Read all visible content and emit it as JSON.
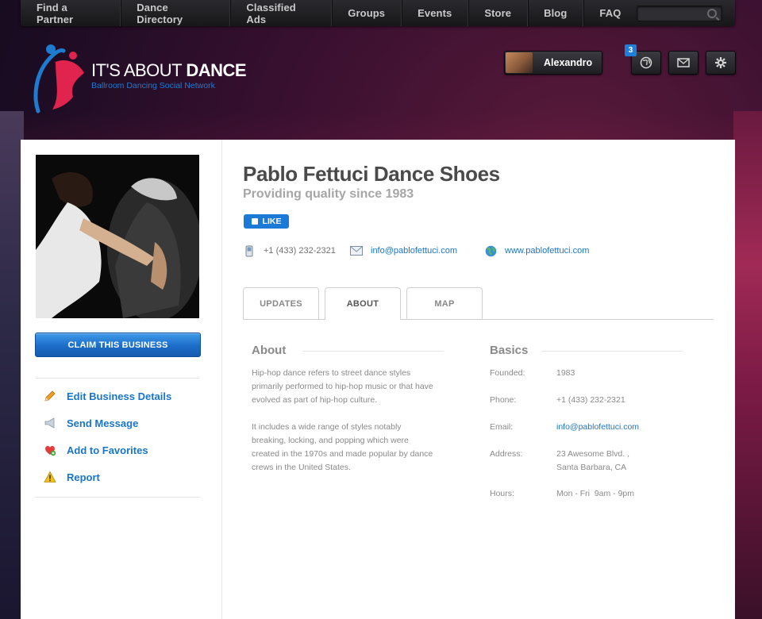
{
  "nav": {
    "items": [
      "Find a Partner",
      "Dance Directory",
      "Classified Ads",
      "Groups",
      "Events",
      "Store",
      "Blog",
      "FAQ"
    ],
    "search_placeholder": ""
  },
  "logo": {
    "title_light": "IT'S ABOUT ",
    "title_bold": "DANCE",
    "subtitle": "Ballroom Dancing Social Network"
  },
  "user": {
    "name": "Alexandro",
    "notification_count": "3",
    "icons": [
      "globe-icon",
      "mail-icon",
      "gear-icon"
    ]
  },
  "sidebar": {
    "claim_label": "CLAIM THIS BUSINESS",
    "actions": [
      {
        "label": "Edit Business Details",
        "icon": "pencil-icon"
      },
      {
        "label": "Send Message",
        "icon": "megaphone-icon"
      },
      {
        "label": "Add to Favorites",
        "icon": "heart-icon"
      },
      {
        "label": "Report",
        "icon": "warning-icon"
      }
    ]
  },
  "business": {
    "name": "Pablo Fettuci Dance Shoes",
    "tagline": "Providing quality since 1983",
    "like_label": "LIKE",
    "phone": "+1 (433) 232-2321",
    "email": "info@pablofettuci.com",
    "website": "www.pablofettuci.com"
  },
  "tabs": [
    {
      "label": "UPDATES",
      "active": false
    },
    {
      "label": "ABOUT",
      "active": true
    },
    {
      "label": "MAP",
      "active": false
    }
  ],
  "about": {
    "title": "About",
    "paragraphs": [
      "Hip-hop dance refers to street dance styles primarily performed to hip-hop music or that have evolved as part of hip-hop culture.",
      "It includes a wide range of styles notably breaking, locking, and popping which were created in the 1970s and made popular by dance crews in the United States."
    ]
  },
  "basics": {
    "title": "Basics",
    "founded_label": "Founded:",
    "founded": "1983",
    "phone_label": "Phone:",
    "phone": "+1 (433) 232-2321",
    "email_label": "Email:",
    "email": "info@pablofettuci.com",
    "address_label": "Address:",
    "address_line1": "23 Awesome Blvd. ,",
    "address_line2": "Santa Barbara, CA",
    "hours_label": "Hours:",
    "hours": "Mon - Fri  9am - 9pm"
  },
  "colors": {
    "accent_blue": "#1a75c9",
    "brand_red": "#e0244d",
    "button_blue": "#1c6dc9"
  }
}
